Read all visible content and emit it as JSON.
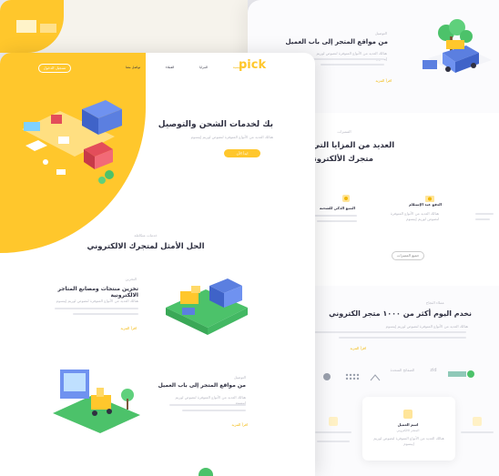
{
  "colors": {
    "accent": "#FFC72C",
    "text": "#2f3041",
    "muted": "#b7b8c2",
    "green": "#4cc26a"
  },
  "header": {
    "logo": "pick",
    "nav": [
      "الرئيسية",
      "المزايا",
      "العملاء",
      "تواصل معنا"
    ],
    "cta": "تسجيل الدخول"
  },
  "hero": {
    "title": "بك لخدمات الشحن والتوصيل",
    "subtitle": "هنالك العديد من الأنواع المتوفرة لنصوص لوريم إيبسوم",
    "button": "ابدأ الآن"
  },
  "solution": {
    "eyebrow": "خدمات متكاملة",
    "title": "الحل الأمثل لمتجرك الالكتروني"
  },
  "feature_storage": {
    "eyebrow": "التخزين",
    "title": "تخزين منتجات ومصانع المتاجر الالكترونية",
    "text": "هنالك العديد من الأنواع المتوفرة لنصوص لوريم إيبسوم",
    "link": "اقرأ المزيد"
  },
  "feature_delivery": {
    "eyebrow": "التوصيل",
    "title": "من مواقع المتجر إلى باب العميل",
    "text": "هنالك العديد من الأنواع المتوفرة لنصوص لوريم إيبسوم",
    "link": "اقرأ المزيد"
  },
  "back_delivery": {
    "eyebrow": "التوصيل",
    "title": "من مواقع المتجر إلى باب العميل",
    "text": "هنالك العديد من الأنواع المتوفرة لنصوص لوريم إيبسوم",
    "link": "اقرأ المزيد"
  },
  "advantages": {
    "eyebrow": "المميزات",
    "title_line1": "العديد من المزايا التي تناسب",
    "title_line2": "متجرك الألكتروني",
    "items": [
      {
        "title": "الدفع عند الإستلام",
        "text": "هنالك العديد من الأنواع المتوفرة لنصوص لوريم إيبسوم"
      },
      {
        "title": "التتبع الذكي للشحنة",
        "text": "هنالك العديد من الأنواع المتوفرة لنصوص لوريم إيبسوم"
      }
    ],
    "button": "جميع المميزات"
  },
  "clients": {
    "eyebrow": "عملاء النجاح",
    "title": "نخدم اليوم أكثر من ١٠٠٠ متجر الكتروني",
    "text": "هنالك العديد من الأنواع المتوفرة لنصوص لوريم إيبسوم",
    "link": "اقرأ المزيد",
    "logos": [
      "الصفائح المتحدة",
      "zid",
      "salla"
    ]
  },
  "testimonial": {
    "name": "اسم العميل",
    "role": "المتجر الالكتروني",
    "text": "هنالك العديد من الأنواع المتوفرة لنصوص لوريم إيبسوم"
  }
}
